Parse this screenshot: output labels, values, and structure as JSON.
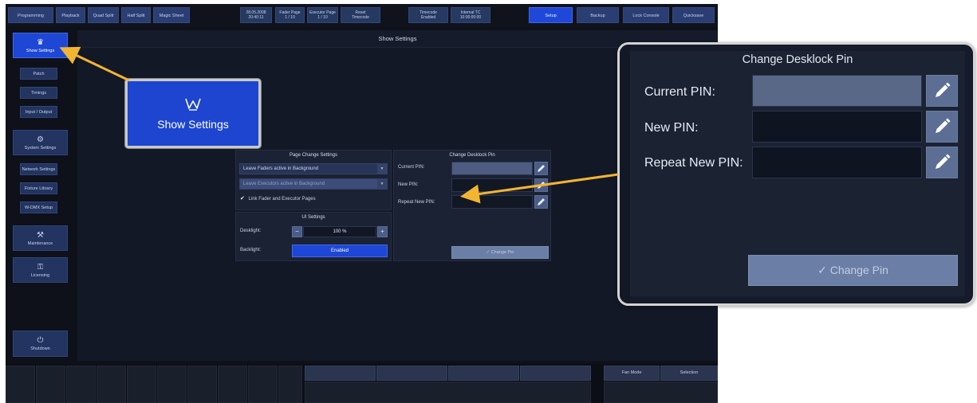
{
  "topbar": {
    "tabs": [
      "Programming",
      "Playback",
      "Quad Split",
      "Half Split",
      "Magic Sheet"
    ],
    "info": [
      {
        "line1": "28.05.2008",
        "line2": "20:40:11"
      },
      {
        "line1": "Fader Page",
        "line2": "1 / 10"
      },
      {
        "line1": "Executor Page",
        "line2": "1 / 10"
      },
      {
        "line1": "Reset",
        "line2": "Timecode"
      },
      {
        "line1": "Timecode",
        "line2": "Enabled"
      },
      {
        "line1": "Internal TC",
        "line2": "10:00:00:00"
      }
    ],
    "actions": [
      "Setup",
      "Backup",
      "Lock Console",
      "Quicksave"
    ]
  },
  "content": {
    "title": "Show Settings"
  },
  "sidebar": {
    "show_settings": "Show Settings",
    "show_sub": [
      "Patch",
      "Timings",
      "Input / Output"
    ],
    "system_settings": "System Settings",
    "system_sub": [
      "Network Settings",
      "Fixture Library",
      "W-DMX Setup"
    ],
    "maintenance": "Maintenance",
    "licensing": "Licensing",
    "shutdown": "Shutdown"
  },
  "page_change": {
    "title": "Page Change Settings",
    "faders_option": "Leave Faders active in Background",
    "executors_option": "Leave Executors active in Background",
    "link_label": "Link Fader and Executor Pages"
  },
  "ui_settings": {
    "title": "UI Settings",
    "desklight_label": "Desklight:",
    "desklight_value": "100 %",
    "backlight_label": "Backlight:",
    "backlight_value": "Enabled"
  },
  "desklock_small": {
    "title": "Change Desklock Pin",
    "current": "Current PIN:",
    "new": "New PIN:",
    "repeat": "Repeat New PIN:",
    "button": "✓ Change Pin"
  },
  "bottom": {
    "fan_mode": "Fan Mode",
    "selection": "Selection"
  },
  "zoom_button": {
    "label": "Show Settings"
  },
  "zoom_panel": {
    "title": "Change Desklock Pin",
    "current_label": "Current PIN:",
    "new_label": "New PIN:",
    "repeat_label": "Repeat New PIN:",
    "change_label": "✓ Change Pin"
  },
  "colors": {
    "accent_blue": "#1e47d6",
    "callout_arrow": "#f2b531",
    "panel_bg": "#1b2233"
  },
  "icons": [
    "crown-icon",
    "gears-icon",
    "wrench-icon",
    "key-icon",
    "power-icon",
    "pencil-icon",
    "check-icon",
    "dropdown-arrow-icon"
  ]
}
